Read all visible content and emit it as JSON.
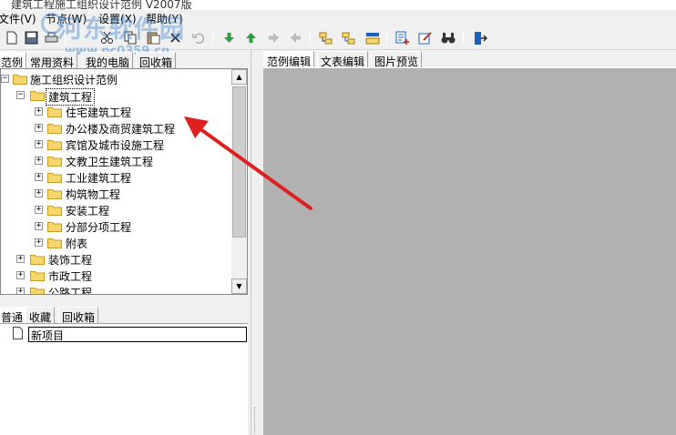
{
  "window": {
    "title": "建筑工程施工组织设计范例 V2007版"
  },
  "menu": {
    "items": [
      {
        "label": "文件(V)"
      },
      {
        "label": "节点(W)"
      },
      {
        "label": "设置(X)"
      },
      {
        "label": "帮助(Y)"
      }
    ]
  },
  "toolbar": {
    "icons": [
      "new-file-icon",
      "save-icon",
      "print-icon",
      "cut-icon",
      "copy-icon",
      "paste-icon",
      "delete-icon",
      "undo-icon",
      "move-down-icon",
      "move-up-icon",
      "move-right-icon",
      "move-left-icon",
      "add-sibling-node-icon",
      "add-child-node-icon",
      "node-properties-icon",
      "add-item-icon",
      "edit-item-icon",
      "search-icon",
      "exit-icon"
    ]
  },
  "watermark": {
    "text": "河东软件园",
    "url": "www.pc0359.cn"
  },
  "left_tabs": [
    {
      "label": "范例",
      "active": true
    },
    {
      "label": "常用资料",
      "active": false
    },
    {
      "label": "我的电脑",
      "active": false
    },
    {
      "label": "回收箱",
      "active": false
    }
  ],
  "tree": {
    "rows": [
      {
        "label": "施工组织设计范例",
        "expander": "−"
      },
      {
        "label": "建筑工程",
        "expander": "−"
      },
      {
        "label": "住宅建筑工程",
        "expander": "+"
      },
      {
        "label": "办公楼及商贸建筑工程",
        "expander": "+"
      },
      {
        "label": "宾馆及城市设施工程",
        "expander": "+"
      },
      {
        "label": "文教卫生建筑工程",
        "expander": "+"
      },
      {
        "label": "工业建筑工程",
        "expander": "+"
      },
      {
        "label": "构筑物工程",
        "expander": "+"
      },
      {
        "label": "安装工程",
        "expander": "+"
      },
      {
        "label": "分部分项工程",
        "expander": "+"
      },
      {
        "label": "附表",
        "expander": "+"
      },
      {
        "label": "装饰工程",
        "expander": "+"
      },
      {
        "label": "市政工程",
        "expander": "+"
      },
      {
        "label": "公路工程",
        "expander": "+"
      }
    ],
    "scroll_up": "▲",
    "scroll_down": "▼"
  },
  "lower_tabs": [
    {
      "label": "普通",
      "active": true
    },
    {
      "label": "收藏",
      "active": false
    },
    {
      "label": "回收箱",
      "active": false
    }
  ],
  "lower_list": {
    "new_item": "新项目"
  },
  "right_tabs": [
    {
      "label": "范例编辑",
      "active": true
    },
    {
      "label": "文表编辑",
      "active": false
    },
    {
      "label": "图片预览",
      "active": false
    }
  ],
  "colors": {
    "folder": "#f5d76e",
    "folder_border": "#c89b28",
    "editor_background": "#b1b1b1",
    "annotation_arrow": "#e02020",
    "toolbar_green": "#2f9e3f",
    "toolbar_blue": "#1c5fc2"
  }
}
